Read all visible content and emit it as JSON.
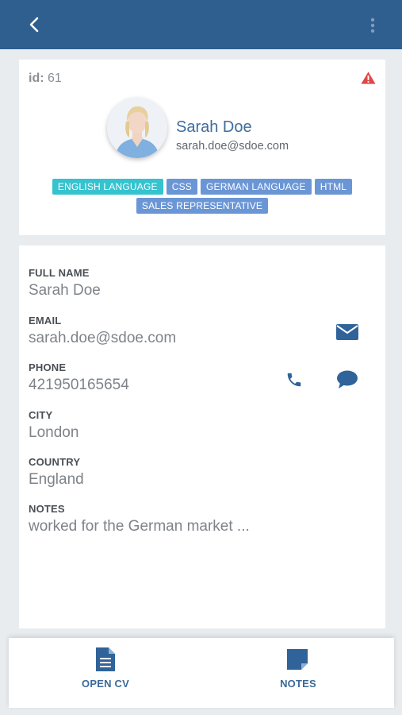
{
  "header": {
    "back_icon": "chevron-left-icon",
    "menu_icon": "more-vertical-icon",
    "background": "#2f5f8e"
  },
  "profile": {
    "id_label": "id:",
    "id_value": "61",
    "warning_icon": "warning-triangle-icon",
    "warning_color": "#e04848",
    "name": "Sarah Doe",
    "email": "sarah.doe@sdoe.com",
    "tags_row1": [
      "ENGLISH LANGUAGE",
      "CSS",
      "GERMAN LANGUAGE",
      "HTML"
    ],
    "tags_row2": [
      "SALES REPRESENTATIVE"
    ]
  },
  "details": {
    "full_name": {
      "label": "FULL NAME",
      "value": "Sarah Doe"
    },
    "email": {
      "label": "EMAIL",
      "value": "sarah.doe@sdoe.com"
    },
    "phone": {
      "label": "PHONE",
      "value": "421950165654"
    },
    "city": {
      "label": "CITY",
      "value": "London"
    },
    "country": {
      "label": "COUNTRY",
      "value": "England"
    },
    "notes": {
      "label": "NOTES",
      "value": "worked for the German market ..."
    },
    "actions": {
      "email_icon": "envelope-icon",
      "call_icon": "phone-icon",
      "message_icon": "chat-bubble-icon"
    }
  },
  "bottom_bar": {
    "open_cv": {
      "label": "OPEN CV",
      "icon": "document-icon"
    },
    "notes": {
      "label": "NOTES",
      "icon": "note-icon"
    }
  }
}
